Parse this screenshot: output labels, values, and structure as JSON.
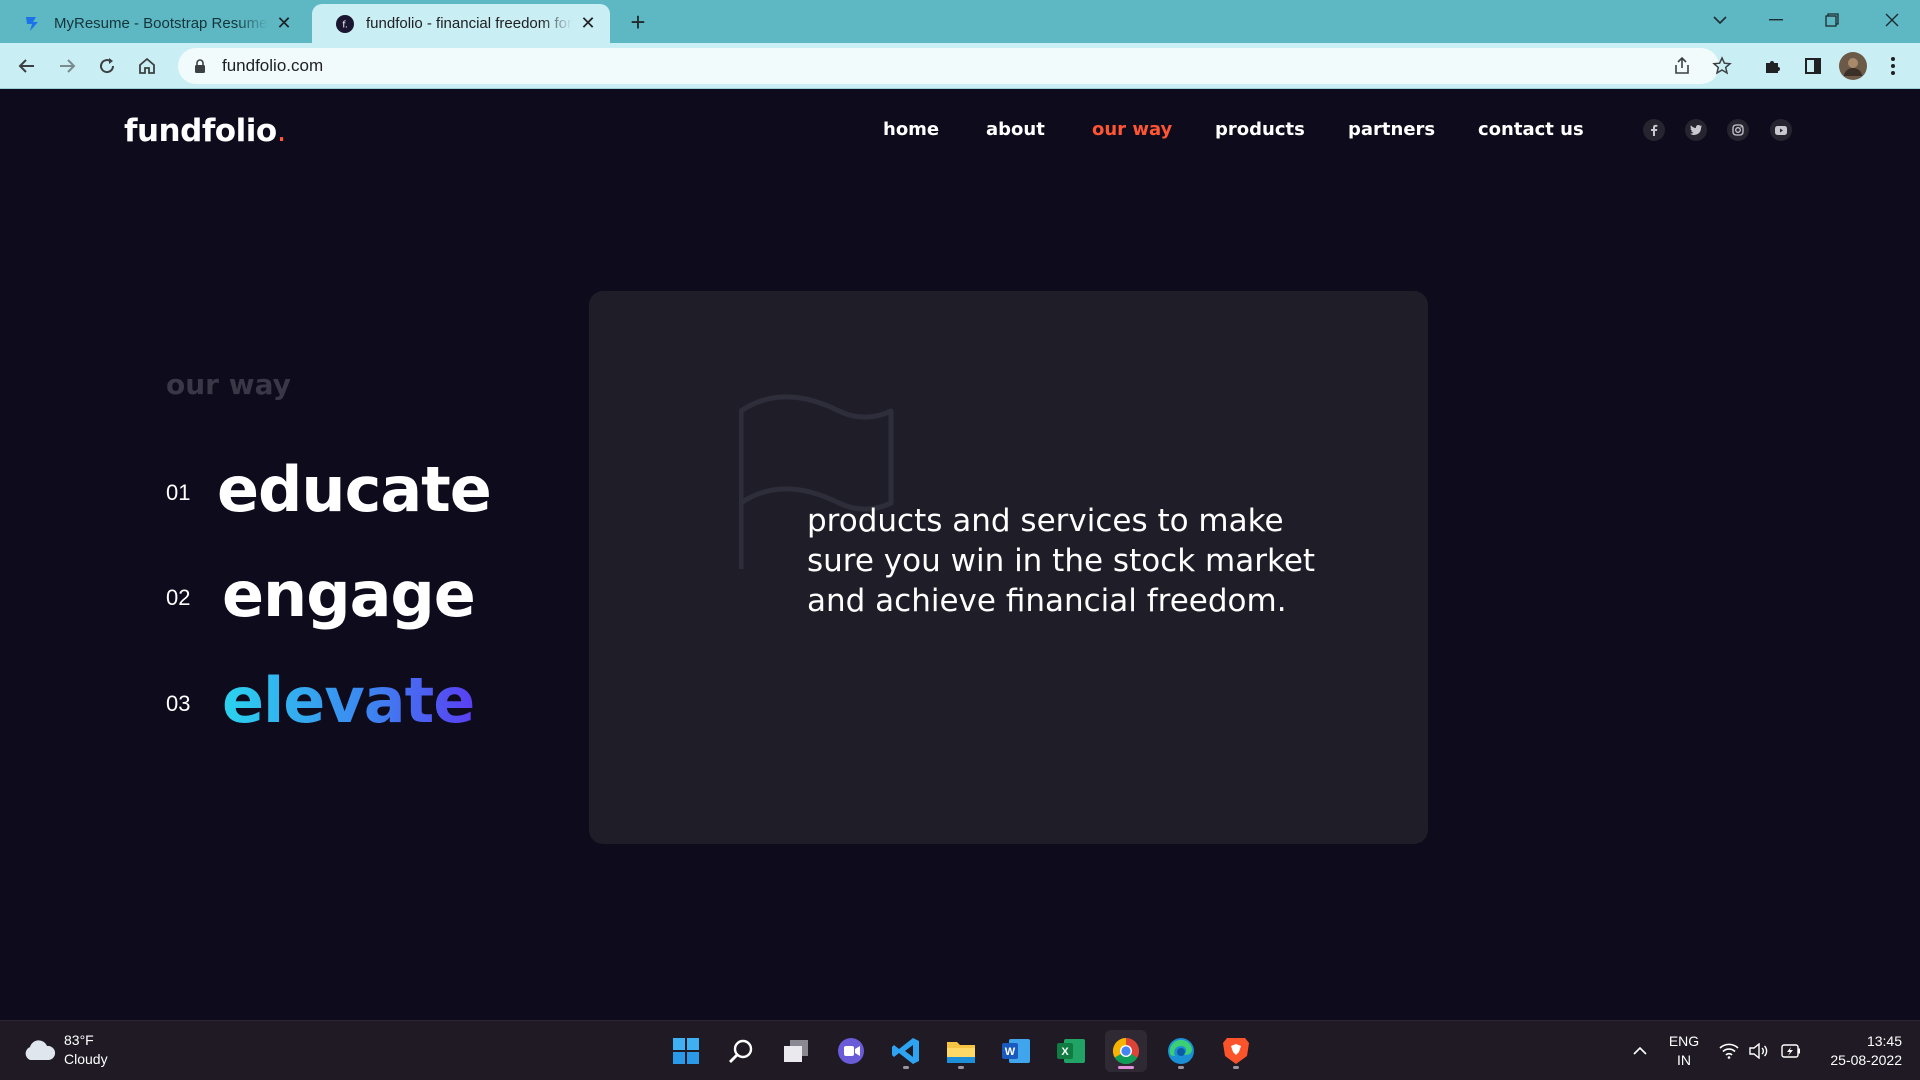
{
  "browser": {
    "tabs": [
      {
        "title": "MyResume - Bootstrap Resume and CV Template",
        "active": false
      },
      {
        "title": "fundfolio - financial freedom for all",
        "active": true
      }
    ],
    "new_tab": "+",
    "url": "fundfolio.com",
    "window_controls": [
      "tab-search",
      "minimize",
      "restore",
      "close"
    ]
  },
  "site": {
    "logo_main": "fundfolio",
    "logo_dot": ".",
    "nav": [
      {
        "label": "home",
        "active": false
      },
      {
        "label": "about",
        "active": false
      },
      {
        "label": "our way",
        "active": true
      },
      {
        "label": "products",
        "active": false
      },
      {
        "label": "partners",
        "active": false
      },
      {
        "label": "contact us",
        "active": false
      }
    ],
    "social": [
      "facebook-icon",
      "twitter-icon",
      "instagram-icon",
      "youtube-icon"
    ],
    "accent_color": "#ff5534",
    "section_label": "our way",
    "steps": [
      {
        "num": "01",
        "word": "educate"
      },
      {
        "num": "02",
        "word": "engage"
      },
      {
        "num": "03",
        "word": "elevate"
      }
    ],
    "card_lines": [
      "products and services to make",
      "sure you win in the stock market",
      "and achieve financial freedom."
    ]
  },
  "taskbar": {
    "weather_temp": "83°F",
    "weather_desc": "Cloudy",
    "apps": [
      "start",
      "search",
      "task-view",
      "teams-chat",
      "vscode",
      "file-explorer",
      "word",
      "excel",
      "chrome",
      "edge",
      "brave"
    ],
    "lang_line1": "ENG",
    "lang_line2": "IN",
    "time": "13:45",
    "date": "25-08-2022"
  }
}
